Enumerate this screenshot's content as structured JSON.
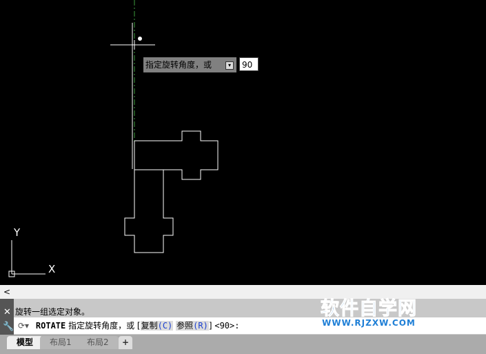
{
  "tooltip": {
    "prompt": "指定旋转角度，或",
    "value": "90"
  },
  "ucs": {
    "x": "X",
    "y": "Y"
  },
  "scroll": {
    "left_arrow": "<"
  },
  "command": {
    "history": "旋转一组选定对象。",
    "name": "ROTATE",
    "prompt": "指定旋转角度，或 [",
    "opt1": "复制",
    "opt1_key": "(C)",
    "opt2": "参照",
    "opt2_key": "(R)",
    "close": "]",
    "default": "<90>:"
  },
  "watermark": {
    "title": "软件自学网",
    "url": "WWW.RJZXW.COM"
  },
  "tabs": [
    {
      "label": "模型"
    },
    {
      "label": "布局1"
    },
    {
      "label": "布局2"
    },
    {
      "label": "+"
    }
  ],
  "colors": {
    "dashed_line": "#3c9c3c",
    "linework": "#ffffff"
  }
}
